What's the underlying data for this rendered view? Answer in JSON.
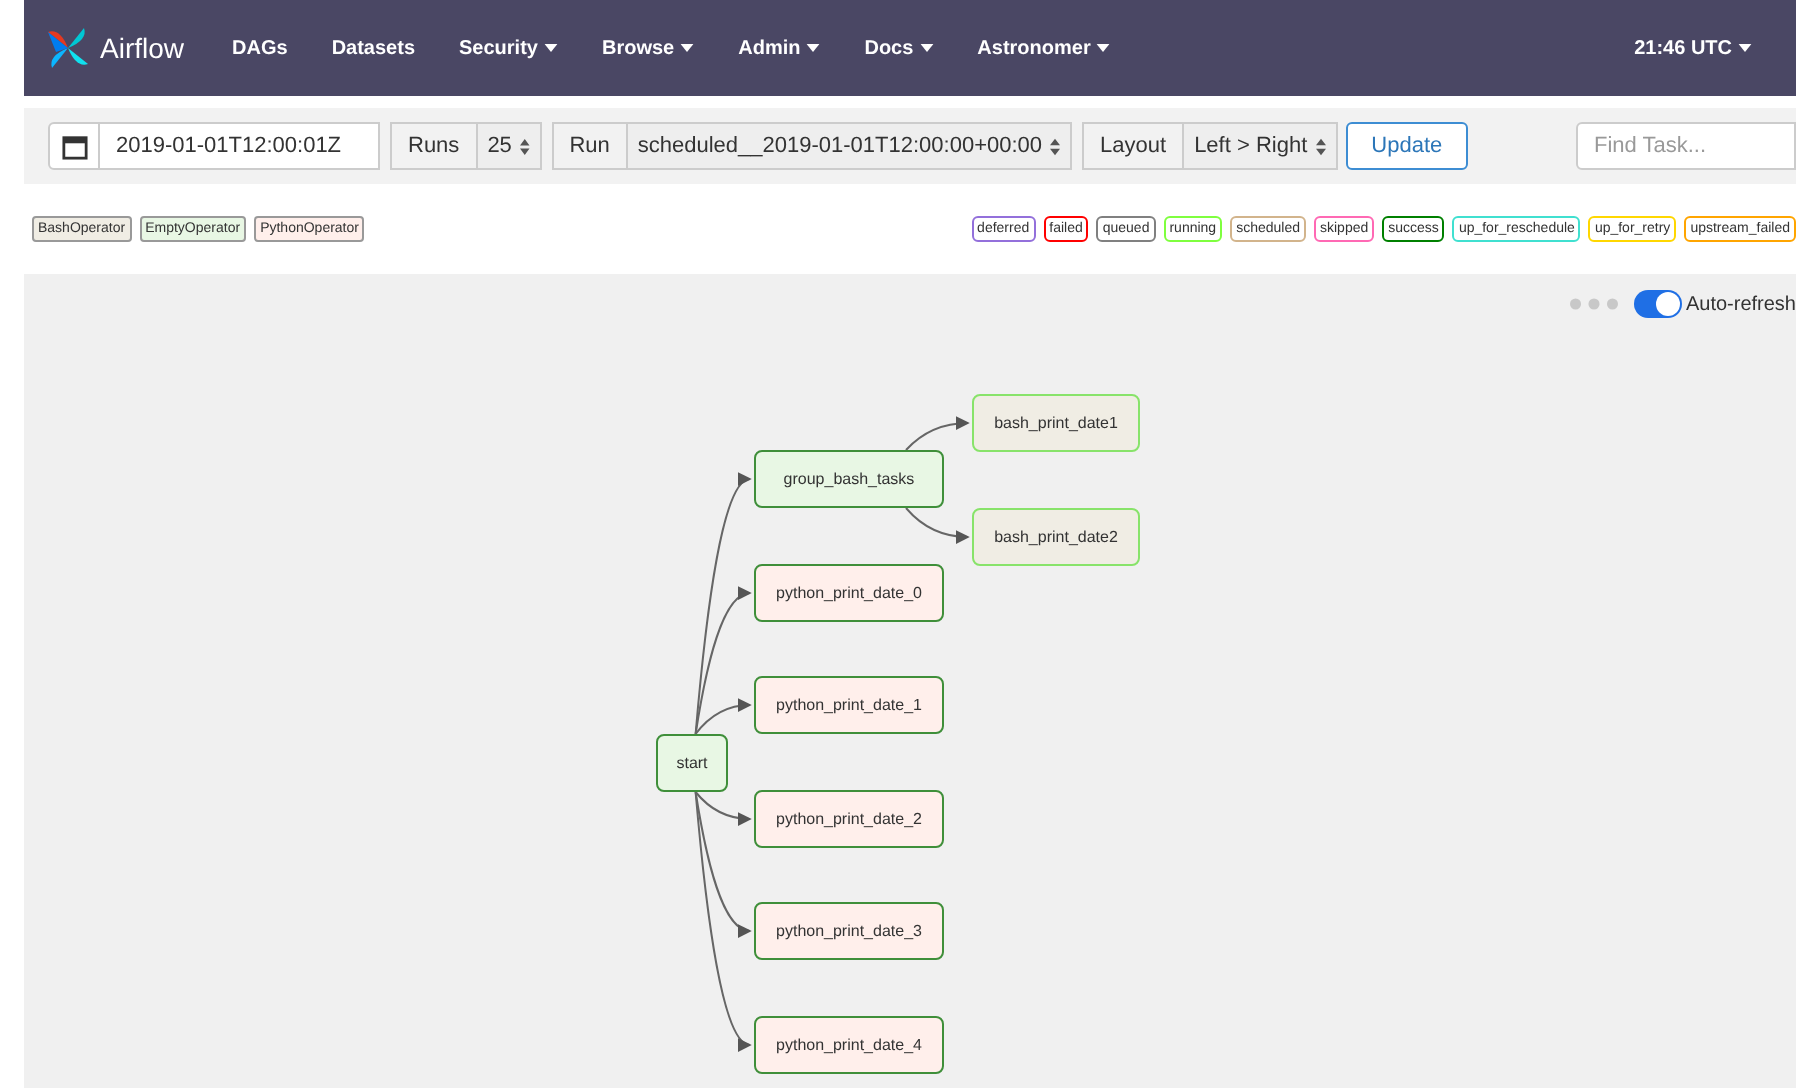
{
  "navbar": {
    "brand": "Airflow",
    "menus": [
      {
        "label": "DAGs",
        "dropdown": false
      },
      {
        "label": "Datasets",
        "dropdown": false
      },
      {
        "label": "Security",
        "dropdown": true
      },
      {
        "label": "Browse",
        "dropdown": true
      },
      {
        "label": "Admin",
        "dropdown": true
      },
      {
        "label": "Docs",
        "dropdown": true
      },
      {
        "label": "Astronomer",
        "dropdown": true
      }
    ],
    "clock": {
      "label": "21:46 UTC",
      "dropdown": true
    }
  },
  "toolbar": {
    "date": "2019-01-01T12:00:01Z",
    "runs_label": "Runs",
    "runs": "25",
    "run_label": "Run",
    "run": "scheduled__2019-01-01T12:00:00+00:00",
    "layout_label": "Layout",
    "layout": "Left > Right",
    "update": "Update",
    "search": {
      "placeholder": "Find Task..."
    }
  },
  "operators": [
    {
      "label": "BashOperator",
      "color": "#f0ede4"
    },
    {
      "label": "EmptyOperator",
      "color": "#e8f7e4"
    },
    {
      "label": "PythonOperator",
      "color": "#ffefeb"
    }
  ],
  "states": [
    {
      "label": "deferred",
      "color": "#9370db"
    },
    {
      "label": "failed",
      "color": "#ff0000"
    },
    {
      "label": "queued",
      "color": "#808080"
    },
    {
      "label": "running",
      "color": "#7fff3f"
    },
    {
      "label": "scheduled",
      "color": "#d2b48c"
    },
    {
      "label": "skipped",
      "color": "#ff69b4"
    },
    {
      "label": "success",
      "color": "#008000"
    },
    {
      "label": "up_for_reschedule",
      "color": "#40e0d0"
    },
    {
      "label": "up_for_retry",
      "color": "#ffd700"
    },
    {
      "label": "upstream_failed",
      "color": "#ffa500"
    }
  ],
  "auto_refresh": {
    "label": "Auto-refresh",
    "on": true
  },
  "graph": {
    "label": "start",
    "kind": "success",
    "color": "#e8f7e4",
    "children": [
      {
        "label": "group_bash_tasks",
        "kind": "success",
        "color": "#e8f7e4",
        "children": [
          {
            "label": "bash_print_date1",
            "kind": "running",
            "color": "#f0ede4"
          },
          {
            "label": "bash_print_date2",
            "kind": "running",
            "color": "#f0ede4"
          }
        ]
      },
      {
        "label": "python_print_date_0",
        "kind": "success",
        "color": "#ffefeb"
      },
      {
        "label": "python_print_date_1",
        "kind": "success",
        "color": "#ffefeb"
      },
      {
        "label": "python_print_date_2",
        "kind": "success",
        "color": "#ffefeb"
      },
      {
        "label": "python_print_date_3",
        "kind": "success",
        "color": "#ffefeb"
      },
      {
        "label": "python_print_date_4",
        "kind": "success",
        "color": "#ffefeb"
      }
    ]
  }
}
